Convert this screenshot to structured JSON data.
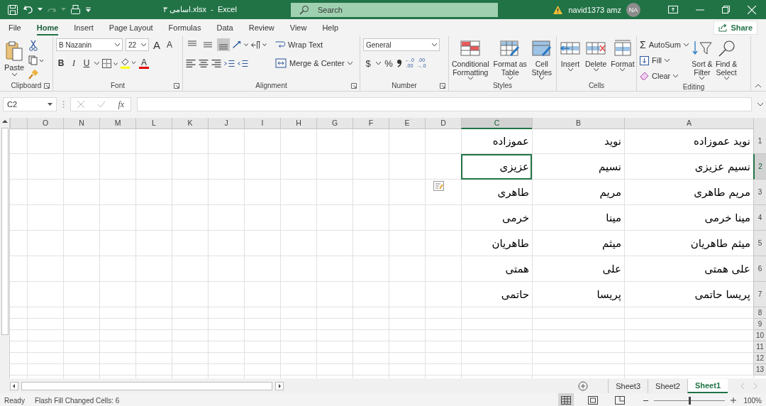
{
  "title_bar": {
    "title": "اسامی ۳.xlsx  -  Excel",
    "search": {
      "placeholder": "Search"
    },
    "user": "navid1373 amz",
    "avatar": "NA"
  },
  "menu_tabs": [
    {
      "label": "Help",
      "selected": false
    },
    {
      "label": "View",
      "selected": false
    },
    {
      "label": "Review",
      "selected": false
    },
    {
      "label": "Data",
      "selected": false
    },
    {
      "label": "Formulas",
      "selected": false
    },
    {
      "label": "Page Layout",
      "selected": false
    },
    {
      "label": "Insert",
      "selected": false
    },
    {
      "label": "Home",
      "selected": true
    },
    {
      "label": "File",
      "selected": false
    }
  ],
  "share": "Share",
  "ribbon": {
    "clipboard": {
      "label": "Clipboard",
      "paste": "Paste"
    },
    "font": {
      "label": "Font",
      "font_name": "B Nazanin",
      "font_size": "22",
      "grow": "A",
      "shrink": "A",
      "bold": "B",
      "italic": "I",
      "underline": "U",
      "font_color": "A"
    },
    "alignment": {
      "label": "Alignment",
      "wrap_text": "Wrap Text",
      "merge": "Merge & Center"
    },
    "number": {
      "label": "Number",
      "format": "General",
      "currency": "$",
      "percent": "%",
      "decimals": [
        {
          "top": ".00",
          "bottom": "→.0"
        },
        {
          "top": "←.0",
          "bottom": ".00"
        }
      ]
    },
    "styles": {
      "label": "Styles",
      "buttons": [
        {
          "kind": "cellstyles",
          "lines": [
            "Cell",
            "Styles"
          ]
        },
        {
          "kind": "table",
          "lines": [
            "Format as",
            "Table"
          ]
        },
        {
          "kind": "conditional",
          "lines": [
            "Conditional",
            "Formatting"
          ]
        }
      ]
    },
    "cells": {
      "label": "Cells",
      "buttons": [
        {
          "kind": "format",
          "lines": [
            "Format"
          ]
        },
        {
          "kind": "delete",
          "lines": [
            "Delete"
          ]
        },
        {
          "kind": "insert",
          "lines": [
            "Insert"
          ]
        }
      ]
    },
    "editing": {
      "label": "Editing",
      "autosum_symbol": "Σ",
      "autosum": "AutoSum",
      "fill": "Fill",
      "clear": "Clear",
      "buttons": [
        {
          "kind": "find",
          "lines": [
            "Find &",
            "Select"
          ]
        },
        {
          "kind": "sort",
          "lines": [
            "Sort &",
            "Filter"
          ]
        }
      ]
    }
  },
  "formula_bar": {
    "name_box": "C2",
    "fx": "fx"
  },
  "sheet": {
    "flash_fill_options": true,
    "columns": [
      {
        "label": "A",
        "selected": false
      },
      {
        "label": "B",
        "selected": false
      },
      {
        "label": "C",
        "selected": true
      },
      {
        "label": "D",
        "selected": false
      },
      {
        "label": "E",
        "selected": false
      },
      {
        "label": "F",
        "selected": false
      },
      {
        "label": "G",
        "selected": false
      },
      {
        "label": "H",
        "selected": false
      },
      {
        "label": "I",
        "selected": false
      },
      {
        "label": "J",
        "selected": false
      },
      {
        "label": "K",
        "selected": false
      },
      {
        "label": "L",
        "selected": false
      },
      {
        "label": "M",
        "selected": false
      },
      {
        "label": "N",
        "selected": false
      },
      {
        "label": "O",
        "selected": false
      }
    ],
    "rows": [
      {
        "number": "1",
        "selected": false,
        "cells": [
          {
            "text": "نوید عموزاده",
            "selected": false
          },
          {
            "text": "نوید",
            "selected": false
          },
          {
            "text": "عموزاده",
            "selected": false
          }
        ]
      },
      {
        "number": "2",
        "selected": true,
        "cells": [
          {
            "text": "نسیم عزیزی",
            "selected": false
          },
          {
            "text": "نسیم",
            "selected": false
          },
          {
            "text": "عزیزی",
            "selected": true
          }
        ]
      },
      {
        "number": "3",
        "selected": false,
        "cells": [
          {
            "text": "مریم طاهری",
            "selected": false
          },
          {
            "text": "مریم",
            "selected": false
          },
          {
            "text": "طاهری",
            "selected": false
          }
        ]
      },
      {
        "number": "4",
        "selected": false,
        "cells": [
          {
            "text": "مینا خرمی",
            "selected": false
          },
          {
            "text": "مینا",
            "selected": false
          },
          {
            "text": "خرمی",
            "selected": false
          }
        ]
      },
      {
        "number": "5",
        "selected": false,
        "cells": [
          {
            "text": "میثم طاهریان",
            "selected": false
          },
          {
            "text": "میثم",
            "selected": false
          },
          {
            "text": "طاهریان",
            "selected": false
          }
        ]
      },
      {
        "number": "6",
        "selected": false,
        "cells": [
          {
            "text": "علی همتی",
            "selected": false
          },
          {
            "text": "علی",
            "selected": false
          },
          {
            "text": "همتی",
            "selected": false
          }
        ]
      },
      {
        "number": "7",
        "selected": false,
        "cells": [
          {
            "text": "پریسا حاتمی",
            "selected": false
          },
          {
            "text": "پریسا",
            "selected": false
          },
          {
            "text": "حاتمی",
            "selected": false
          }
        ]
      },
      {
        "number": "8",
        "selected": false
      },
      {
        "number": "9",
        "selected": false
      },
      {
        "number": "10",
        "selected": false
      },
      {
        "number": "11",
        "selected": false
      },
      {
        "number": "12",
        "selected": false
      },
      {
        "number": "13",
        "selected": false
      }
    ]
  },
  "sheet_tabs": [
    {
      "label": "Sheet1",
      "selected": true
    },
    {
      "label": "Sheet2",
      "selected": false
    },
    {
      "label": "Sheet3",
      "selected": false
    }
  ],
  "status_bar": {
    "state": "Ready",
    "message": "Flash Fill Changed Cells: 6",
    "zoom": "100%",
    "zoom_slider": {
      "level": 0.5
    }
  }
}
